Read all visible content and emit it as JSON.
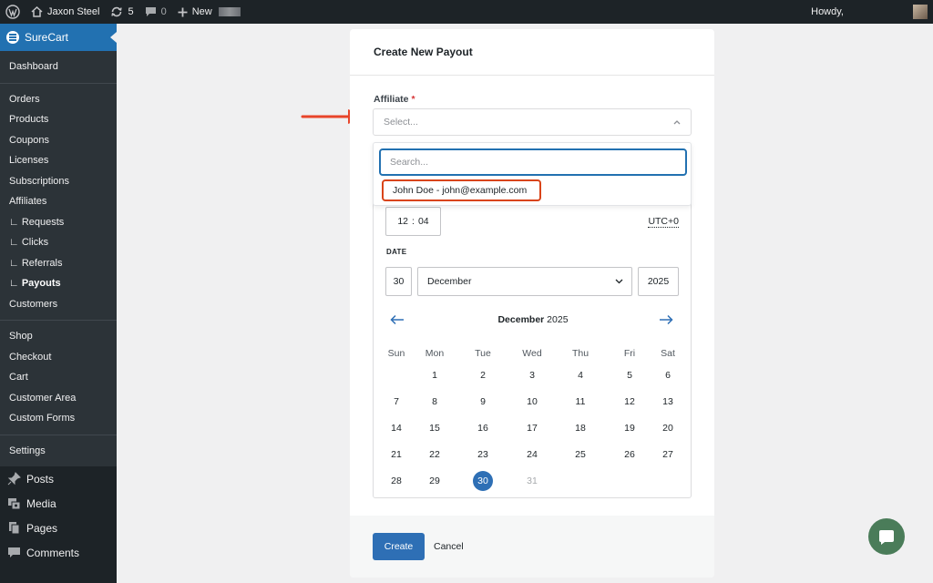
{
  "adminbar": {
    "site_name": "Jaxon Steel",
    "updates_count": "5",
    "comments_count": "0",
    "new_label": "New",
    "howdy": "Howdy,"
  },
  "sidebar": {
    "plugin_name": "SureCart",
    "groups": [
      [
        "Dashboard"
      ],
      [
        "Orders",
        "Products",
        "Coupons",
        "Licenses",
        "Subscriptions",
        "Affiliates",
        "Requests",
        "Clicks",
        "Referrals",
        "Payouts",
        "Customers"
      ],
      [
        "Shop",
        "Checkout",
        "Cart",
        "Customer Area",
        "Custom Forms"
      ],
      [
        "Settings"
      ]
    ],
    "current_item": "Payouts",
    "main_items": [
      "Posts",
      "Media",
      "Pages",
      "Comments"
    ]
  },
  "modal": {
    "title": "Create New Payout",
    "affiliate_label": "Affiliate",
    "required_mark": "*",
    "select_placeholder": "Select...",
    "search_placeholder": "Search...",
    "option": "John Doe - john@example.com",
    "time_hour": "12",
    "time_separator": ":",
    "time_minute": "04",
    "timezone": "UTC+0",
    "date_label": "DATE",
    "day_value": "30",
    "month_value": "December",
    "year_value": "2025",
    "calendar_month": "December",
    "calendar_year": "2025",
    "weekdays": [
      "Sun",
      "Mon",
      "Tue",
      "Wed",
      "Thu",
      "Fri",
      "Sat"
    ],
    "weeks": [
      [
        "",
        "1",
        "2",
        "3",
        "4",
        "5",
        "6"
      ],
      [
        "7",
        "8",
        "9",
        "10",
        "11",
        "12",
        "13"
      ],
      [
        "14",
        "15",
        "16",
        "17",
        "18",
        "19",
        "20"
      ],
      [
        "21",
        "22",
        "23",
        "24",
        "25",
        "26",
        "27"
      ],
      [
        "28",
        "29",
        "30",
        "31",
        "",
        "",
        ""
      ]
    ],
    "selected_day": "30",
    "disabled_days": [
      "31"
    ],
    "create_label": "Create",
    "cancel_label": "Cancel"
  },
  "colors": {
    "accent": "#2e6fb5",
    "highlight_outline": "#d94419",
    "chat": "#4a7c59"
  }
}
